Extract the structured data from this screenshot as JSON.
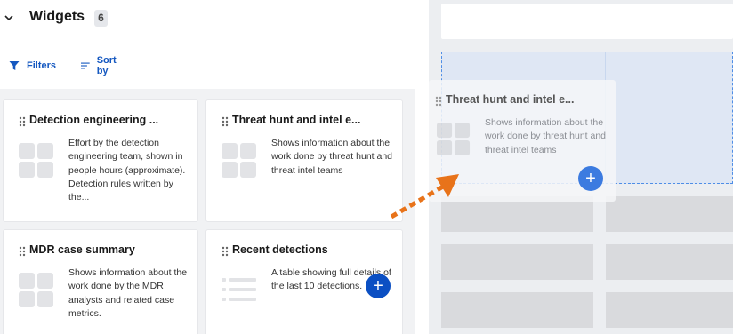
{
  "panel": {
    "title": "Widgets",
    "count": "6",
    "filters_label": "Filters",
    "sortby_label": "Sort by"
  },
  "cards": [
    {
      "title": "Detection engineering ...",
      "description": "Effort by the detection engineering team, shown in people hours (approximate). Detection rules written by the...",
      "icon": "grid-widget-icon"
    },
    {
      "title": "Threat hunt and intel e...",
      "description": "Shows information about the work done by threat hunt and threat intel teams",
      "icon": "grid-widget-icon",
      "add_label": "+"
    },
    {
      "title": "MDR case summary",
      "description": "Shows information about the work done by the MDR analysts and related case metrics.",
      "icon": "grid-widget-icon"
    },
    {
      "title": "Recent detections",
      "description": "A table showing full details of the last 10 detections.",
      "icon": "list-widget-icon"
    }
  ],
  "drag_ghost": {
    "title": "Threat hunt and intel e...",
    "description": "Shows information about the work done by threat hunt and threat intel teams",
    "add_label": "+"
  },
  "colors": {
    "accent": "#0b4fc3",
    "link": "#1558c0",
    "drop_zone_border": "#4f8ee6",
    "arrow": "#e8731a"
  }
}
